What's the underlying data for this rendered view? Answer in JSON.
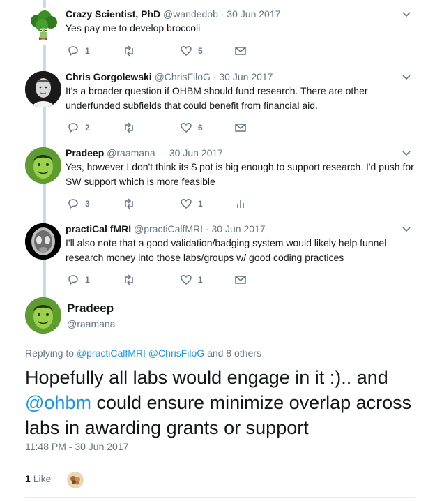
{
  "tweets": [
    {
      "name": "Crazy Scientist, PhD",
      "handle": "@wandedob",
      "dot": "·",
      "date": "30 Jun 2017",
      "text": "Yes pay me to develop broccoli",
      "replies": "1",
      "retweets": "",
      "likes": "5",
      "avatar_icon": "broccoli-avatar",
      "last_action_icon": "envelope-icon"
    },
    {
      "name": "Chris Gorgolewski",
      "handle": "@ChrisFiloG",
      "dot": "·",
      "date": "30 Jun 2017",
      "text": "It's a broader question if OHBM should fund research. There are other underfunded subfields that could benefit from financial aid.",
      "replies": "2",
      "retweets": "",
      "likes": "6",
      "avatar_icon": "person-photo-avatar",
      "last_action_icon": "envelope-icon"
    },
    {
      "name": "Pradeep",
      "handle": "@raamana_",
      "dot": "·",
      "date": "30 Jun 2017",
      "text": "Yes, however I don't think its $ pot is big enough to support research. I'd push for SW support which is more feasible",
      "replies": "3",
      "retweets": "",
      "likes": "1",
      "avatar_icon": "green-face-avatar",
      "last_action_icon": "analytics-icon"
    },
    {
      "name": "practiCal fMRI",
      "handle": "@practiCalfMRI",
      "dot": "·",
      "date": "30 Jun 2017",
      "text": "I'll also note that a good validation/badging system would likely help funnel research money into those labs/groups w/ good coding practices",
      "replies": "1",
      "retweets": "",
      "likes": "1",
      "avatar_icon": "brain-scan-avatar",
      "last_action_icon": "envelope-icon"
    }
  ],
  "main": {
    "name": "Pradeep",
    "handle": "@raamana_",
    "replying_prefix": "Replying to",
    "replying_user1": "@practiCalfMRI",
    "replying_user2": "@ChrisFiloG",
    "replying_suffix": "and 8 others",
    "text_part1": "Hopefully all labs would engage in it :).. and",
    "mention": "@ohbm",
    "text_part2": "could ensure minimize overlap across labs in awarding grants or support",
    "timestamp": "11:48 PM - 30 Jun 2017",
    "like_count": "1",
    "like_label": "Like"
  },
  "colors": {
    "link": "#1b95e0",
    "muted": "#657786",
    "thread_line": "#c4dbe8"
  }
}
